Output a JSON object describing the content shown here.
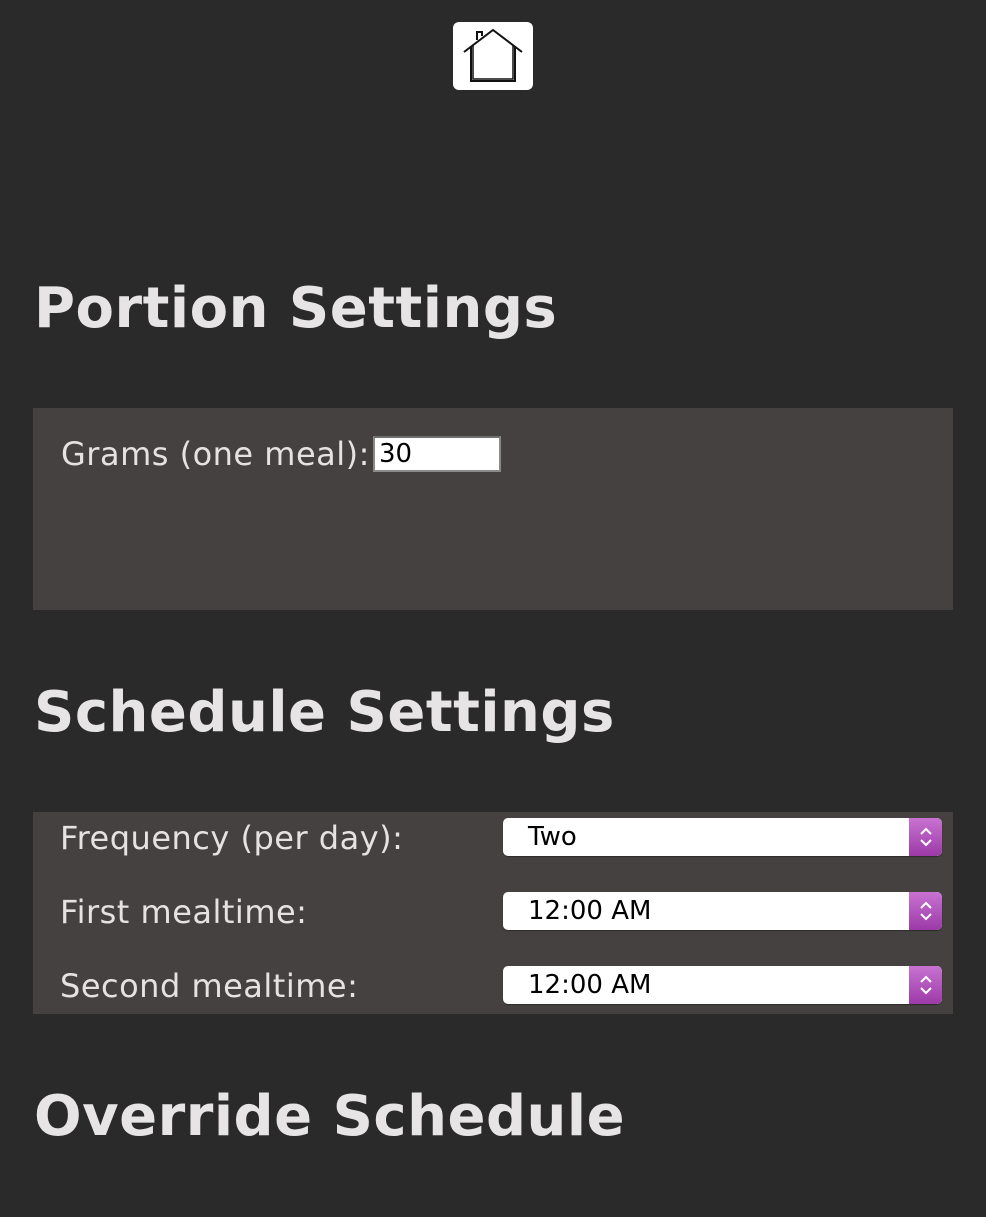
{
  "home": {
    "icon": "home-icon"
  },
  "portion": {
    "title": "Portion Settings",
    "grams_label": "Grams (one meal):",
    "grams_value": "30"
  },
  "schedule": {
    "title": "Schedule Settings",
    "frequency_label": "Frequency (per day):",
    "frequency_value": "Two",
    "first_label": "First mealtime:",
    "first_value": "12:00 AM",
    "second_label": "Second mealtime:",
    "second_value": "12:00 AM"
  },
  "override": {
    "title": "Override Schedule"
  },
  "colors": {
    "background": "#2b2a2b",
    "panel": "#444140",
    "stepper_accent": "#b455c0"
  }
}
